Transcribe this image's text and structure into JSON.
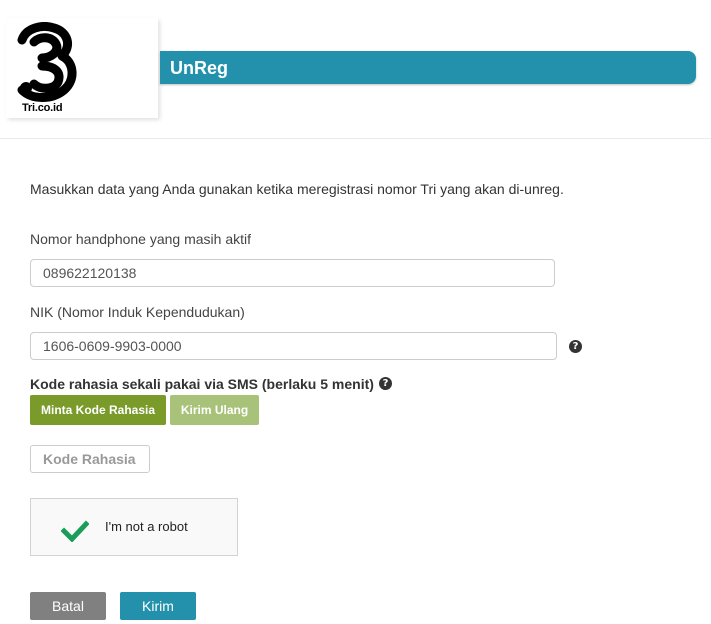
{
  "header": {
    "logo_text": "Tri.co.id",
    "title": "UnReg"
  },
  "form": {
    "intro": "Masukkan data yang Anda gunakan ketika meregistrasi nomor Tri yang akan di-unreg.",
    "phone_label": "Nomor handphone yang masih aktif",
    "phone_value": "089622120138",
    "nik_label": "NIK (Nomor Induk Kependudukan)",
    "nik_value": "1606-0609-9903-0000",
    "sms_label": "Kode rahasia sekali pakai via SMS (berlaku 5 menit)",
    "request_code_button": "Minta Kode Rahasia",
    "resend_button": "Kirim Ulang",
    "code_placeholder": "Kode Rahasia",
    "captcha_text": "I'm not a robot",
    "cancel_button": "Batal",
    "submit_button": "Kirim"
  },
  "colors": {
    "accent": "#2391ab",
    "green_button": "#7a9a2a",
    "green_button_disabled": "#a9c27a",
    "cancel_gray": "#808080",
    "checkmark": "#1a9c5b"
  },
  "icons": {
    "help": "question-circle-icon",
    "captcha_check": "checkmark-icon"
  }
}
